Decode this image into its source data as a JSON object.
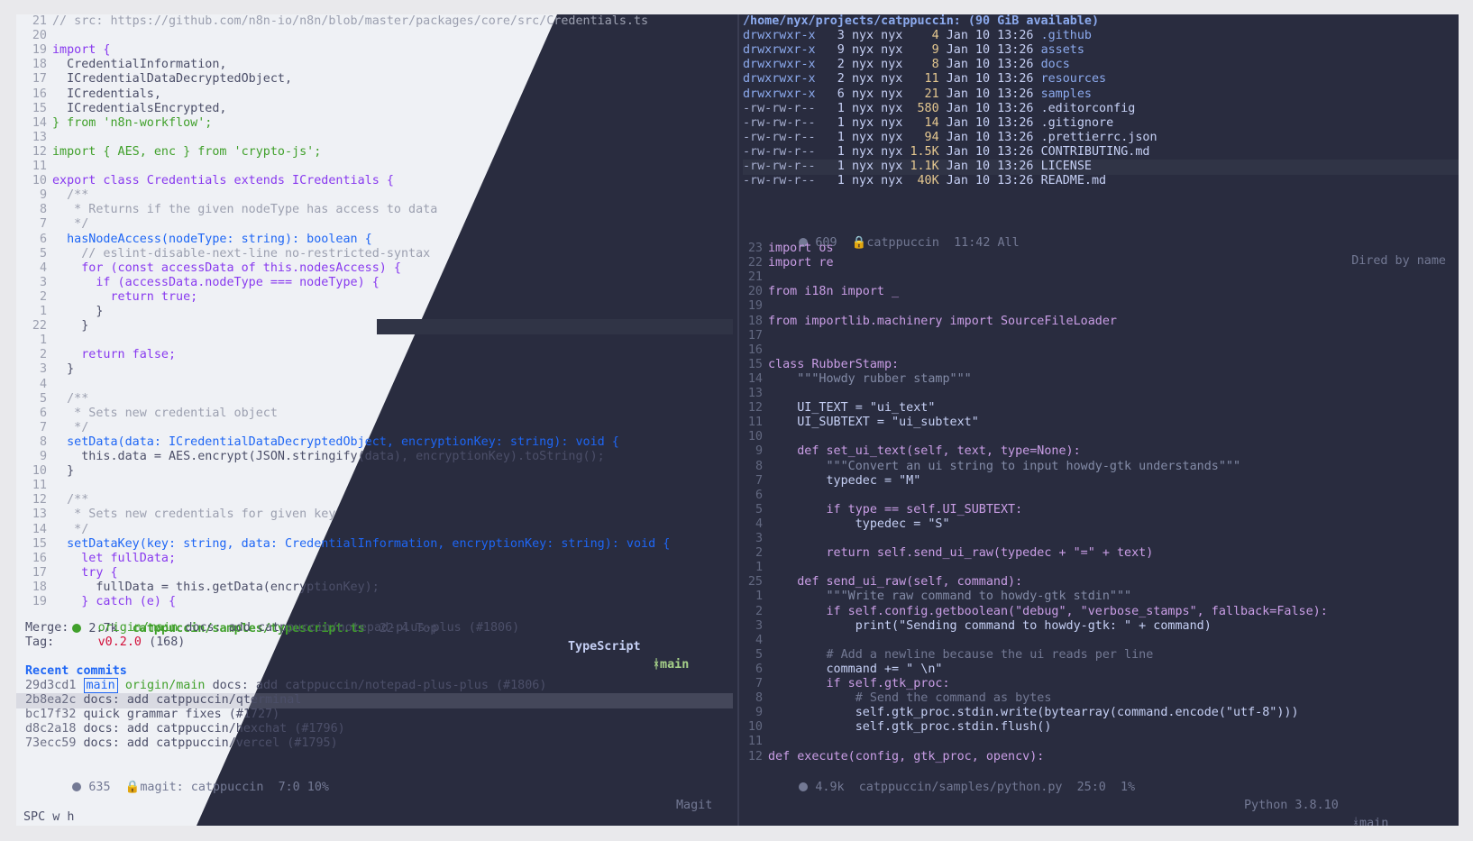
{
  "left_code": {
    "lines": [
      {
        "n": "21",
        "t": "// src: https://github.com/n8n-io/n8n/blob/master/packages/core/src/Credentials.ts",
        "k": "com"
      },
      {
        "n": "20",
        "t": "",
        "k": ""
      },
      {
        "n": "19",
        "t": "import {",
        "k": "kw"
      },
      {
        "n": "18",
        "t": "  CredentialInformation,",
        "k": ""
      },
      {
        "n": "17",
        "t": "  ICredentialDataDecryptedObject,",
        "k": ""
      },
      {
        "n": "16",
        "t": "  ICredentials,",
        "k": ""
      },
      {
        "n": "15",
        "t": "  ICredentialsEncrypted,",
        "k": ""
      },
      {
        "n": "14",
        "t": "} from 'n8n-workflow';",
        "k": "imp"
      },
      {
        "n": "13",
        "t": "",
        "k": ""
      },
      {
        "n": "12",
        "t": "import { AES, enc } from 'crypto-js';",
        "k": "imp"
      },
      {
        "n": "11",
        "t": "",
        "k": ""
      },
      {
        "n": "10",
        "t": "export class Credentials extends ICredentials {",
        "k": "cls"
      },
      {
        "n": "9",
        "t": "  /**",
        "k": "com"
      },
      {
        "n": "8",
        "t": "   * Returns if the given nodeType has access to data",
        "k": "com"
      },
      {
        "n": "7",
        "t": "   */",
        "k": "com"
      },
      {
        "n": "6",
        "t": "  hasNodeAccess(nodeType: string): boolean {",
        "k": "fn"
      },
      {
        "n": "5",
        "t": "    // eslint-disable-next-line no-restricted-syntax",
        "k": "com"
      },
      {
        "n": "4",
        "t": "    for (const accessData of this.nodesAccess) {",
        "k": "kw"
      },
      {
        "n": "3",
        "t": "      if (accessData.nodeType === nodeType) {",
        "k": "kw"
      },
      {
        "n": "2",
        "t": "        return true;",
        "k": "kw"
      },
      {
        "n": "1",
        "t": "      }",
        "k": ""
      },
      {
        "n": "22",
        "t": "    }",
        "k": "cur"
      },
      {
        "n": "1",
        "t": "",
        "k": ""
      },
      {
        "n": "2",
        "t": "    return false;",
        "k": "kw"
      },
      {
        "n": "3",
        "t": "  }",
        "k": ""
      },
      {
        "n": "4",
        "t": "",
        "k": ""
      },
      {
        "n": "5",
        "t": "  /**",
        "k": "com"
      },
      {
        "n": "6",
        "t": "   * Sets new credential object",
        "k": "com"
      },
      {
        "n": "7",
        "t": "   */",
        "k": "com"
      },
      {
        "n": "8",
        "t": "  setData(data: ICredentialDataDecryptedObject, encryptionKey: string): void {",
        "k": "fn"
      },
      {
        "n": "9",
        "t": "    this.data = AES.encrypt(JSON.stringify(data), encryptionKey).toString();",
        "k": ""
      },
      {
        "n": "10",
        "t": "  }",
        "k": ""
      },
      {
        "n": "11",
        "t": "",
        "k": ""
      },
      {
        "n": "12",
        "t": "  /**",
        "k": "com"
      },
      {
        "n": "13",
        "t": "   * Sets new credentials for given key",
        "k": "com"
      },
      {
        "n": "14",
        "t": "   */",
        "k": "com"
      },
      {
        "n": "15",
        "t": "  setDataKey(key: string, data: CredentialInformation, encryptionKey: string): void {",
        "k": "fn"
      },
      {
        "n": "16",
        "t": "    let fullData;",
        "k": "kw"
      },
      {
        "n": "17",
        "t": "    try {",
        "k": "kw"
      },
      {
        "n": "18",
        "t": "      fullData = this.getData(encryptionKey);",
        "k": ""
      },
      {
        "n": "19",
        "t": "    } catch (e) {",
        "k": "kw"
      }
    ]
  },
  "left_modeline": {
    "size": "2.7k",
    "file": "catppuccin/samples/typescript.ts",
    "pos": "22:4 Top",
    "mode": "TypeScript",
    "branch": "main"
  },
  "magit": {
    "merge_label": "Merge:",
    "merge_ref": "origin/main",
    "merge_msg": "docs: add catppuccin/notepad-plus-plus (#1806)",
    "tag_label": "Tag:",
    "tag_ref": "v0.2.0",
    "tag_count": "(168)",
    "recent_title": "Recent commits",
    "commits": [
      {
        "hash": "29d3cd1",
        "local": "main",
        "remote": "origin/main",
        "msg": "docs: add catppuccin/notepad-plus-plus (#1806)"
      },
      {
        "hash": "2b8ea2c",
        "local": "",
        "remote": "",
        "msg": "docs: add catppuccin/qterminal"
      },
      {
        "hash": "bc17f32",
        "local": "",
        "remote": "",
        "msg": "quick grammar fixes (#1727)"
      },
      {
        "hash": "d8c2a18",
        "local": "",
        "remote": "",
        "msg": "docs: add catppuccin/hexchat (#1796)"
      },
      {
        "hash": "73ecc59",
        "local": "",
        "remote": "",
        "msg": "docs: add catppuccin/vercel (#1795)"
      }
    ]
  },
  "magit_modeline": {
    "size": "635",
    "buffer": "magit: catppuccin",
    "pos": "7:0 10%",
    "mode": "Magit"
  },
  "echo_area": "SPC w h",
  "dired": {
    "header": "/home/nyx/projects/catppuccin: (90 GiB available)",
    "entries": [
      {
        "perm": "drwxrwxr-x",
        "links": "3",
        "user": "nyx",
        "group": "nyx",
        "size": "4",
        "date": "Jan 10 13:26",
        "name": ".github",
        "dir": true
      },
      {
        "perm": "drwxrwxr-x",
        "links": "9",
        "user": "nyx",
        "group": "nyx",
        "size": "9",
        "date": "Jan 10 13:26",
        "name": "assets",
        "dir": true
      },
      {
        "perm": "drwxrwxr-x",
        "links": "2",
        "user": "nyx",
        "group": "nyx",
        "size": "8",
        "date": "Jan 10 13:26",
        "name": "docs",
        "dir": true
      },
      {
        "perm": "drwxrwxr-x",
        "links": "2",
        "user": "nyx",
        "group": "nyx",
        "size": "11",
        "date": "Jan 10 13:26",
        "name": "resources",
        "dir": true
      },
      {
        "perm": "drwxrwxr-x",
        "links": "6",
        "user": "nyx",
        "group": "nyx",
        "size": "21",
        "date": "Jan 10 13:26",
        "name": "samples",
        "dir": true
      },
      {
        "perm": "-rw-rw-r--",
        "links": "1",
        "user": "nyx",
        "group": "nyx",
        "size": "580",
        "date": "Jan 10 13:26",
        "name": ".editorconfig",
        "dir": false
      },
      {
        "perm": "-rw-rw-r--",
        "links": "1",
        "user": "nyx",
        "group": "nyx",
        "size": "14",
        "date": "Jan 10 13:26",
        "name": ".gitignore",
        "dir": false
      },
      {
        "perm": "-rw-rw-r--",
        "links": "1",
        "user": "nyx",
        "group": "nyx",
        "size": "94",
        "date": "Jan 10 13:26",
        "name": ".prettierrc.json",
        "dir": false
      },
      {
        "perm": "-rw-rw-r--",
        "links": "1",
        "user": "nyx",
        "group": "nyx",
        "size": "1.5K",
        "date": "Jan 10 13:26",
        "name": "CONTRIBUTING.md",
        "dir": false
      },
      {
        "perm": "-rw-rw-r--",
        "links": "1",
        "user": "nyx",
        "group": "nyx",
        "size": "1.1K",
        "date": "Jan 10 13:26",
        "name": "LICENSE",
        "dir": false
      },
      {
        "perm": "-rw-rw-r--",
        "links": "1",
        "user": "nyx",
        "group": "nyx",
        "size": "40K",
        "date": "Jan 10 13:26",
        "name": "README.md",
        "dir": false
      }
    ]
  },
  "dired_modeline": {
    "size": "609",
    "buffer": "catppuccin",
    "pos": "11:42 All",
    "mode": "Dired by name"
  },
  "python_code": {
    "lines": [
      {
        "n": "23",
        "t": "import os"
      },
      {
        "n": "22",
        "t": "import re"
      },
      {
        "n": "21",
        "t": ""
      },
      {
        "n": "20",
        "t": "from i18n import _"
      },
      {
        "n": "19",
        "t": ""
      },
      {
        "n": "18",
        "t": "from importlib.machinery import SourceFileLoader"
      },
      {
        "n": "17",
        "t": ""
      },
      {
        "n": "16",
        "t": ""
      },
      {
        "n": "15",
        "t": "class RubberStamp:"
      },
      {
        "n": "14",
        "t": "    \"\"\"Howdy rubber stamp\"\"\""
      },
      {
        "n": "13",
        "t": ""
      },
      {
        "n": "12",
        "t": "    UI_TEXT = \"ui_text\""
      },
      {
        "n": "11",
        "t": "    UI_SUBTEXT = \"ui_subtext\""
      },
      {
        "n": "10",
        "t": ""
      },
      {
        "n": "9",
        "t": "    def set_ui_text(self, text, type=None):"
      },
      {
        "n": "8",
        "t": "        \"\"\"Convert an ui string to input howdy-gtk understands\"\"\""
      },
      {
        "n": "7",
        "t": "        typedec = \"M\""
      },
      {
        "n": "6",
        "t": ""
      },
      {
        "n": "5",
        "t": "        if type == self.UI_SUBTEXT:"
      },
      {
        "n": "4",
        "t": "            typedec = \"S\""
      },
      {
        "n": "3",
        "t": ""
      },
      {
        "n": "2",
        "t": "        return self.send_ui_raw(typedec + \"=\" + text)"
      },
      {
        "n": "1",
        "t": ""
      },
      {
        "n": "25",
        "t": "    def send_ui_raw(self, command):"
      },
      {
        "n": "1",
        "t": "        \"\"\"Write raw command to howdy-gtk stdin\"\"\""
      },
      {
        "n": "2",
        "t": "        if self.config.getboolean(\"debug\", \"verbose_stamps\", fallback=False):"
      },
      {
        "n": "3",
        "t": "            print(\"Sending command to howdy-gtk: \" + command)"
      },
      {
        "n": "4",
        "t": ""
      },
      {
        "n": "5",
        "t": "        # Add a newline because the ui reads per line"
      },
      {
        "n": "6",
        "t": "        command += \" \\n\""
      },
      {
        "n": "7",
        "t": "        if self.gtk_proc:"
      },
      {
        "n": "8",
        "t": "            # Send the command as bytes"
      },
      {
        "n": "9",
        "t": "            self.gtk_proc.stdin.write(bytearray(command.encode(\"utf-8\")))"
      },
      {
        "n": "10",
        "t": "            self.gtk_proc.stdin.flush()"
      },
      {
        "n": "11",
        "t": ""
      },
      {
        "n": "12",
        "t": "def execute(config, gtk_proc, opencv):"
      }
    ]
  },
  "python_modeline": {
    "size": "4.9k",
    "file": "catppuccin/samples/python.py",
    "pos": "25:0  1%",
    "mode": "Python 3.8.10",
    "branch": "main"
  },
  "colors": {
    "accent_green": "#40a02b",
    "accent_blue": "#1e66f5",
    "dark_bg": "#292c3f",
    "light_bg": "#eff1f5"
  }
}
